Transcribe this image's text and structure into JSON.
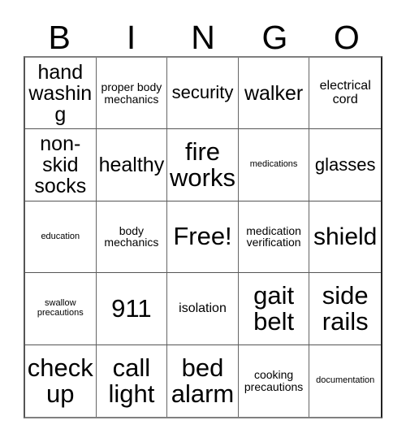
{
  "card": {
    "title_letters": [
      "B",
      "I",
      "N",
      "G",
      "O"
    ],
    "columns": 5,
    "rows": 5,
    "free_space_label": "Free!",
    "colors": {
      "background": "#ffffff",
      "text": "#000000",
      "grid_line": "#666666",
      "grid_border": "#555555"
    }
  },
  "cells": [
    {
      "id": "b1",
      "text": "hand washing",
      "size": "lg"
    },
    {
      "id": "i1",
      "text": "proper body mechanics",
      "size": "xs"
    },
    {
      "id": "n1",
      "text": "security",
      "size": "md"
    },
    {
      "id": "g1",
      "text": "walker",
      "size": "lg"
    },
    {
      "id": "o1",
      "text": "electrical cord",
      "size": "sm"
    },
    {
      "id": "b2",
      "text": "non-skid socks",
      "size": "lg"
    },
    {
      "id": "i2",
      "text": "healthy",
      "size": "lg"
    },
    {
      "id": "n2",
      "text": "fire works",
      "size": "xxl"
    },
    {
      "id": "g2",
      "text": "medications",
      "size": "xxs"
    },
    {
      "id": "o2",
      "text": "glasses",
      "size": "md"
    },
    {
      "id": "b3",
      "text": "education",
      "size": "xxs"
    },
    {
      "id": "i3",
      "text": "body mechanics",
      "size": "xs"
    },
    {
      "id": "n3",
      "text": "Free!",
      "size": "xxl"
    },
    {
      "id": "g3",
      "text": "medication verification",
      "size": "xs"
    },
    {
      "id": "o3",
      "text": "shield",
      "size": "xl"
    },
    {
      "id": "b4",
      "text": "swallow precautions",
      "size": "xxs"
    },
    {
      "id": "i4",
      "text": "911",
      "size": "xxl"
    },
    {
      "id": "n4",
      "text": "isolation",
      "size": "sm"
    },
    {
      "id": "g4",
      "text": "gait belt",
      "size": "xxl"
    },
    {
      "id": "o4",
      "text": "side rails",
      "size": "xxl"
    },
    {
      "id": "b5",
      "text": "check up",
      "size": "xxl"
    },
    {
      "id": "i5",
      "text": "call light",
      "size": "xxl"
    },
    {
      "id": "n5",
      "text": "bed alarm",
      "size": "xxl"
    },
    {
      "id": "g5",
      "text": "cooking precautions",
      "size": "xs"
    },
    {
      "id": "o5",
      "text": "documentation",
      "size": "xxs"
    }
  ]
}
